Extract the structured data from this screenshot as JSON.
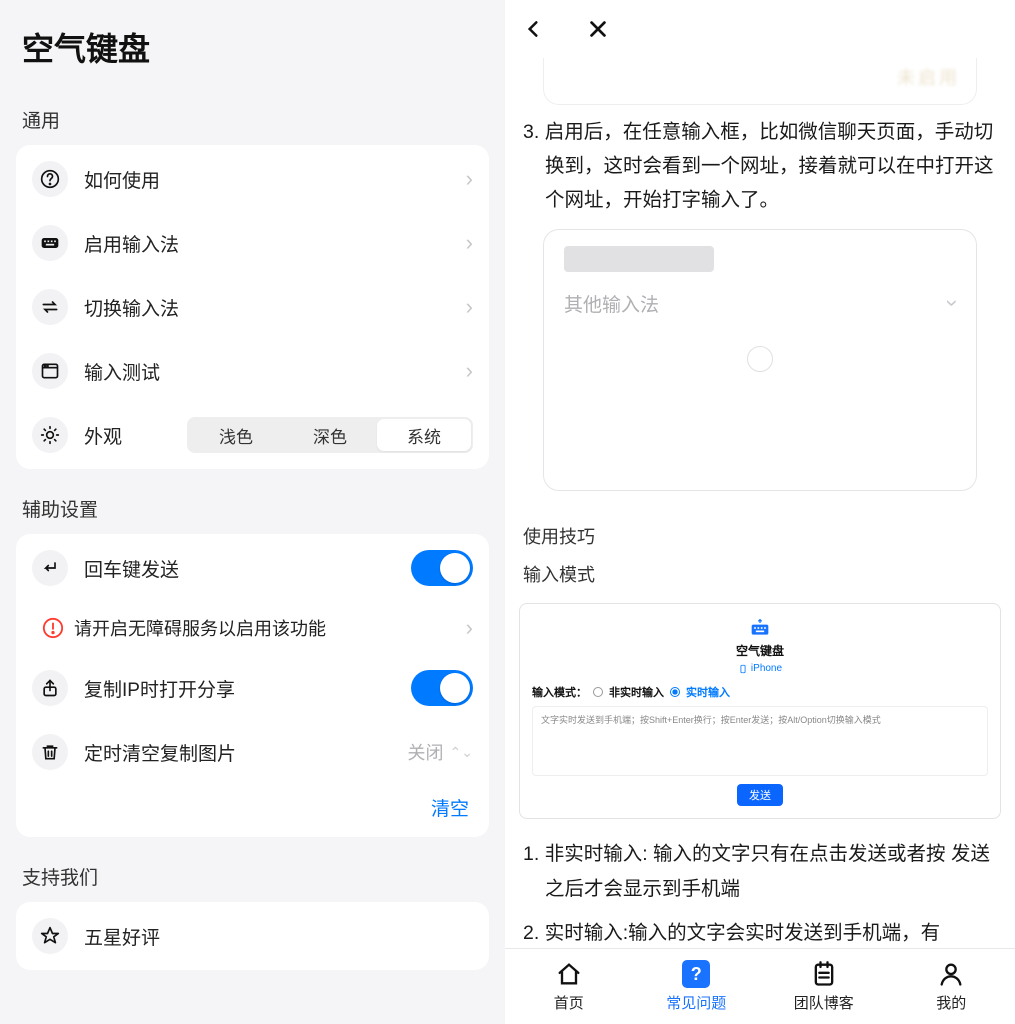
{
  "left": {
    "title": "空气键盘",
    "sections": [
      {
        "title": "通用",
        "rows": [
          {
            "id": "howto",
            "icon": "question",
            "label": "如何使用",
            "type": "nav"
          },
          {
            "id": "enable",
            "icon": "keyboard",
            "label": "启用输入法",
            "type": "nav"
          },
          {
            "id": "switch",
            "icon": "swap",
            "label": "切换输入法",
            "type": "nav"
          },
          {
            "id": "test",
            "icon": "window",
            "label": "输入测试",
            "type": "nav"
          },
          {
            "id": "appearance",
            "icon": "sun",
            "label": "外观",
            "type": "segment",
            "options": [
              "浅色",
              "深色",
              "系统"
            ],
            "selected": 2
          }
        ]
      },
      {
        "title": "辅助设置",
        "rows": [
          {
            "id": "entersend",
            "icon": "enter",
            "label": "回车键发送",
            "type": "toggle",
            "on": true
          },
          {
            "id": "access-warn",
            "icon": "warn",
            "label": "请开启无障碍服务以启用该功能",
            "type": "subnav"
          },
          {
            "id": "copyip",
            "icon": "share",
            "label": "复制IP时打开分享",
            "type": "toggle",
            "on": true
          },
          {
            "id": "autoclear",
            "icon": "trash",
            "label": "定时清空复制图片",
            "type": "picker",
            "value": "关闭"
          }
        ],
        "action": "清空"
      },
      {
        "title": "支持我们",
        "rows": [
          {
            "id": "rate",
            "icon": "star",
            "label": "五星好评",
            "type": "nav"
          }
        ]
      }
    ]
  },
  "right": {
    "top_tag": "未启用",
    "step3_num": "3.",
    "step3_text": "启用后，在任意输入框，比如微信聊天页面，手动切换到，这时会看到一个网址，接着就可以在中打开这个网址，开始打字输入了。",
    "other_ime": "其他输入法",
    "tips_header": "使用技巧",
    "mode_header": "输入模式",
    "wc_title": "空气键盘",
    "wc_sub": "iPhone",
    "wc_mode_label": "输入模式：",
    "wc_opt1": "非实时输入",
    "wc_opt2": "实时输入",
    "wc_hint": "文字实时发送到手机端；按Shift+Enter换行；按Enter发送；按Alt/Option切换输入模式",
    "wc_send": "发送",
    "step1_num": "1.",
    "step1_text": "非实时输入: 输入的文字只有在点击发送或者按 发送之后才会显示到手机端",
    "step2_num": "2.",
    "step2_text": "实时输入:输入的文字会实时发送到手机端，有",
    "tabs": [
      {
        "id": "home",
        "label": "首页",
        "active": false
      },
      {
        "id": "faq",
        "label": "常见问题",
        "active": true
      },
      {
        "id": "blog",
        "label": "团队博客",
        "active": false
      },
      {
        "id": "me",
        "label": "我的",
        "active": false
      }
    ]
  }
}
